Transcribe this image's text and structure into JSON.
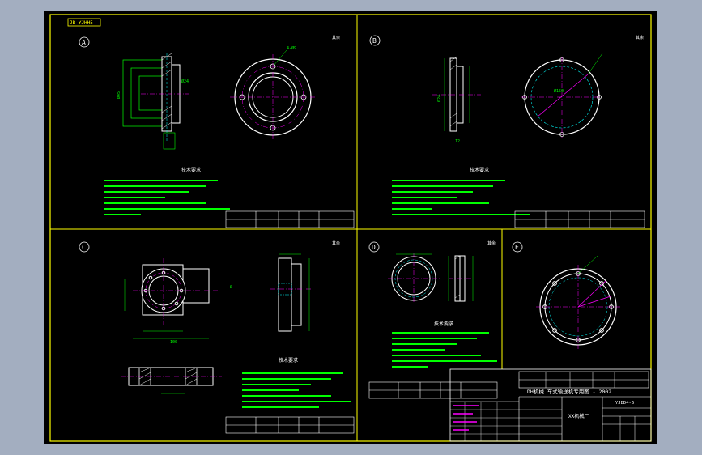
{
  "drawing_code": "JB-YJHH5",
  "zones": [
    {
      "letter": "A",
      "tech_title": "技术要求",
      "roughness": "其余"
    },
    {
      "letter": "B",
      "tech_title": "技术要求",
      "roughness": "其余"
    },
    {
      "letter": "C",
      "tech_title": "技术要求",
      "roughness": "其余"
    },
    {
      "letter": "D",
      "tech_title": "技术要求",
      "roughness": "其余"
    },
    {
      "letter": "E",
      "tech_title": "",
      "roughness": ""
    }
  ],
  "dims": {
    "a_diameter": "Ø24",
    "a_height": "Ø45",
    "b_height": "Ø24",
    "b_diameter": "Ø150",
    "c_width": "Ø",
    "c_bottom": "100"
  },
  "title_block": {
    "title": "DH机械 车式输送机专用图 - 2002",
    "drawing_no": "YJBD4-6",
    "company_stamp": "XX机械厂"
  },
  "colors": {
    "frame": "#ffff00",
    "outline": "#ffffff",
    "dimension": "#00ff00",
    "center": "#ff00ff",
    "hidden": "#00ffff",
    "background": "#000000",
    "desktop": "#a3aec0"
  }
}
